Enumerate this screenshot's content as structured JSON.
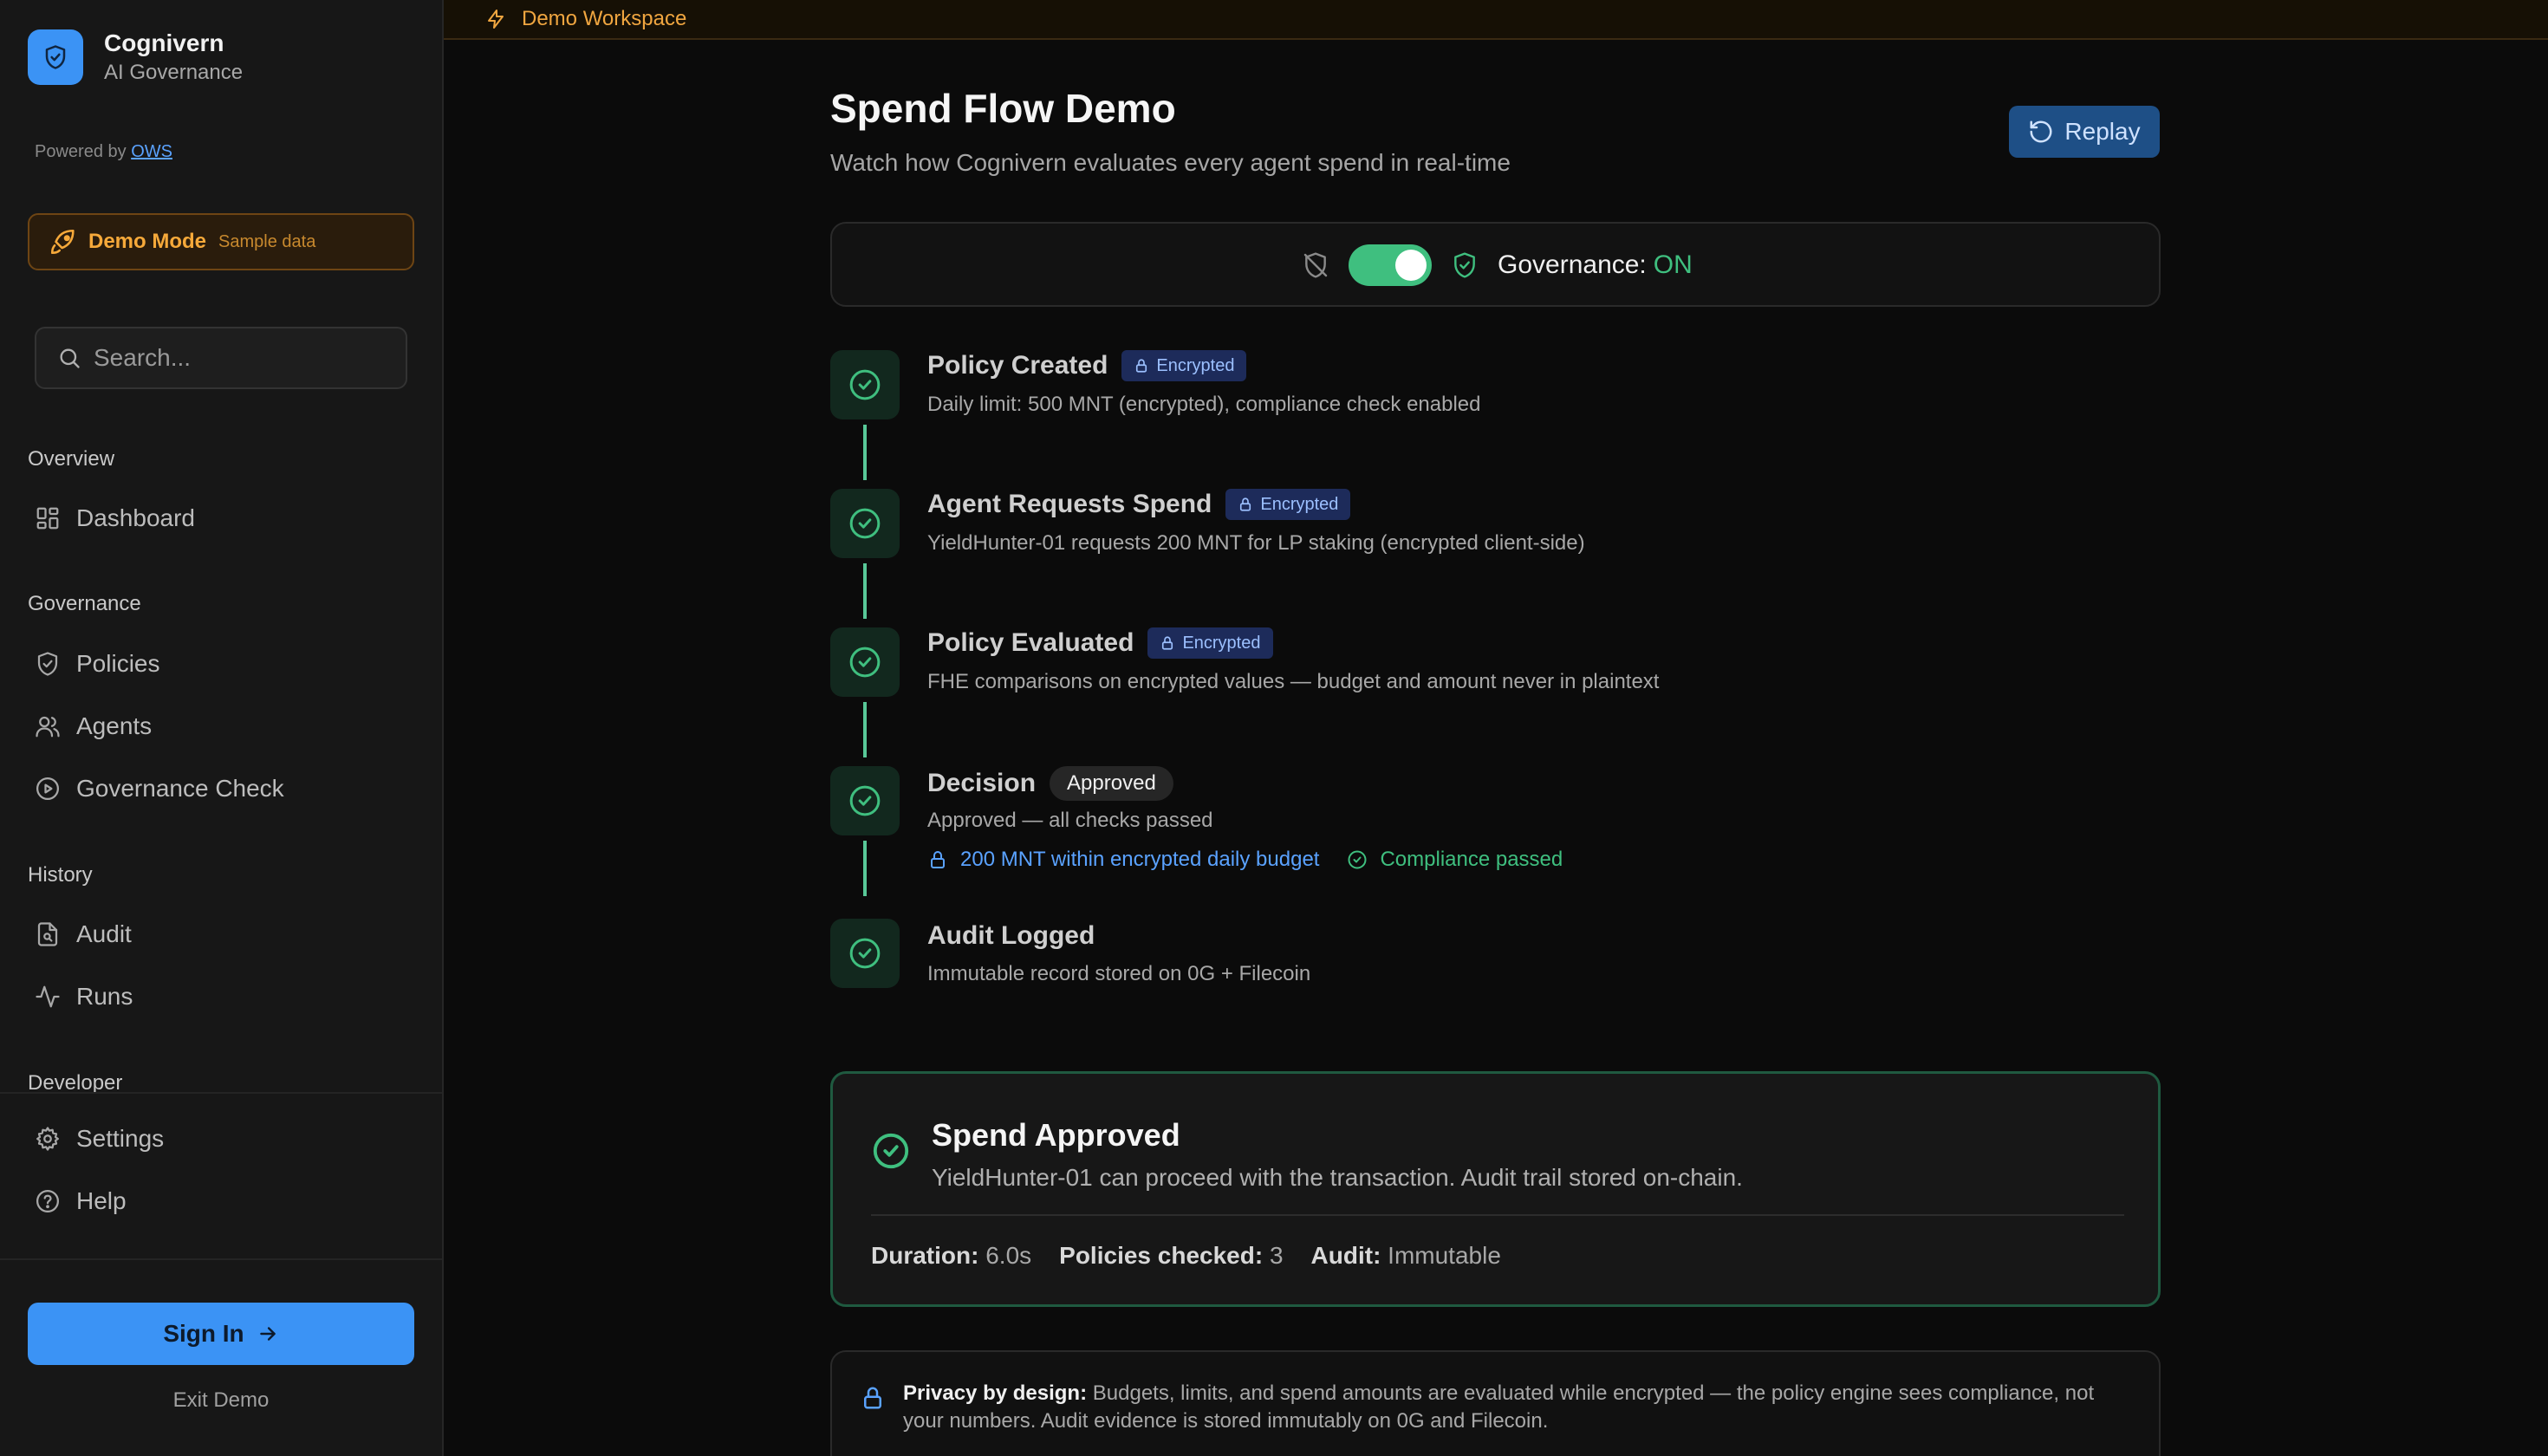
{
  "brand": {
    "name": "Cognivern",
    "subtitle": "AI Governance"
  },
  "powered_by": {
    "prefix": "Powered by",
    "link": "OWS"
  },
  "demo_mode": {
    "label": "Demo Mode",
    "sub": "Sample data"
  },
  "search": {
    "placeholder": "Search..."
  },
  "nav": {
    "overview_label": "Overview",
    "dashboard": "Dashboard",
    "governance_label": "Governance",
    "policies": "Policies",
    "agents": "Agents",
    "governance_check": "Governance Check",
    "history_label": "History",
    "audit": "Audit",
    "runs": "Runs",
    "developer_label": "Developer",
    "settings": "Settings",
    "help": "Help"
  },
  "sign_in": "Sign In",
  "exit_demo": "Exit Demo",
  "banner": {
    "text": "Demo Workspace"
  },
  "page": {
    "title": "Spend Flow Demo",
    "subtitle": "Watch how Cognivern evaluates every agent spend in real-time",
    "replay": "Replay"
  },
  "governance": {
    "label": "Governance:",
    "status": "ON",
    "enabled": true
  },
  "steps": [
    {
      "title": "Policy Created",
      "badge": "Encrypted",
      "desc": "Daily limit: 500 MNT (encrypted), compliance check enabled"
    },
    {
      "title": "Agent Requests Spend",
      "badge": "Encrypted",
      "desc": "YieldHunter-01 requests 200 MNT for LP staking (encrypted client-side)"
    },
    {
      "title": "Policy Evaluated",
      "badge": "Encrypted",
      "desc": "FHE comparisons on encrypted values — budget and amount never in plaintext"
    },
    {
      "title": "Decision",
      "badge": "Approved",
      "desc": "Approved — all checks passed"
    },
    {
      "title": "Audit Logged",
      "desc": "Immutable record stored on 0G + Filecoin"
    }
  ],
  "decision_checks": {
    "budget": "200 MNT within encrypted daily budget",
    "compliance": "Compliance passed"
  },
  "result": {
    "title": "Spend Approved",
    "desc": "YieldHunter-01 can proceed with the transaction. Audit trail stored on-chain.",
    "duration_label": "Duration:",
    "duration": "6.0s",
    "policies_label": "Policies checked:",
    "policies": "3",
    "audit_label": "Audit:",
    "audit": "Immutable"
  },
  "privacy": {
    "label": "Privacy by design:",
    "text": "Budgets, limits, and spend amounts are evaluated while encrypted — the policy engine sees compliance, not your numbers. Audit evidence is stored immutably on 0G and Filecoin."
  },
  "colors": {
    "accent_blue": "#3b93f5",
    "success_green": "#3fbf7f",
    "demo_orange": "#f6a93a",
    "encrypted_badge": "#1d2b5a"
  }
}
